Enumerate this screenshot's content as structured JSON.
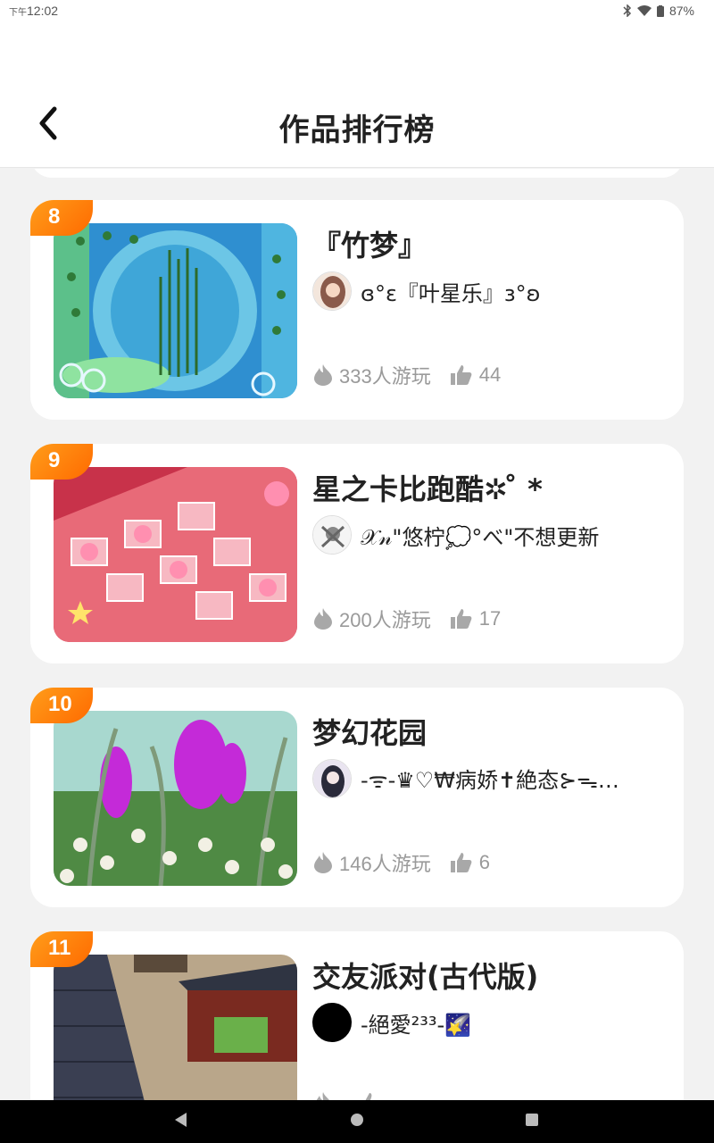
{
  "status_bar": {
    "time_prefix": "下午",
    "time": "12:02",
    "battery": "87%"
  },
  "header": {
    "title": "作品排行榜",
    "back_icon": "chevron-left-icon"
  },
  "items": [
    {
      "rank": "8",
      "title": "『竹梦』",
      "author": "ɞ°ɛ『叶星乐』ɜ°ʚ",
      "plays": "333人游玩",
      "likes": "44",
      "thumb_accent": "#3a9fd8",
      "avatar_color": "#8a5a4a"
    },
    {
      "rank": "9",
      "title": "星之卡比跑酷✲ ̊ *",
      "author": "𝒳𝓃\"悠柠💭°べ\"不想更新",
      "plays": "200人游玩",
      "likes": "17",
      "thumb_accent": "#e86a78",
      "avatar_color": "#eeeeee"
    },
    {
      "rank": "10",
      "title": "梦幻花园",
      "author": "-ᯤ-♛♡₩病娇✝絶态⊱ᯓ…",
      "plays": "146人游玩",
      "likes": "6",
      "thumb_accent": "#b83ad8",
      "avatar_color": "#d9d2e6"
    },
    {
      "rank": "11",
      "title": "交友派对(古代版)",
      "author": "-絕愛²³³-🌠",
      "plays": "",
      "likes": "",
      "thumb_accent": "#8a6a3a",
      "avatar_color": "#000000"
    }
  ],
  "colors": {
    "accent": "#ff7a00",
    "stat_gray": "#9a9a9a"
  }
}
